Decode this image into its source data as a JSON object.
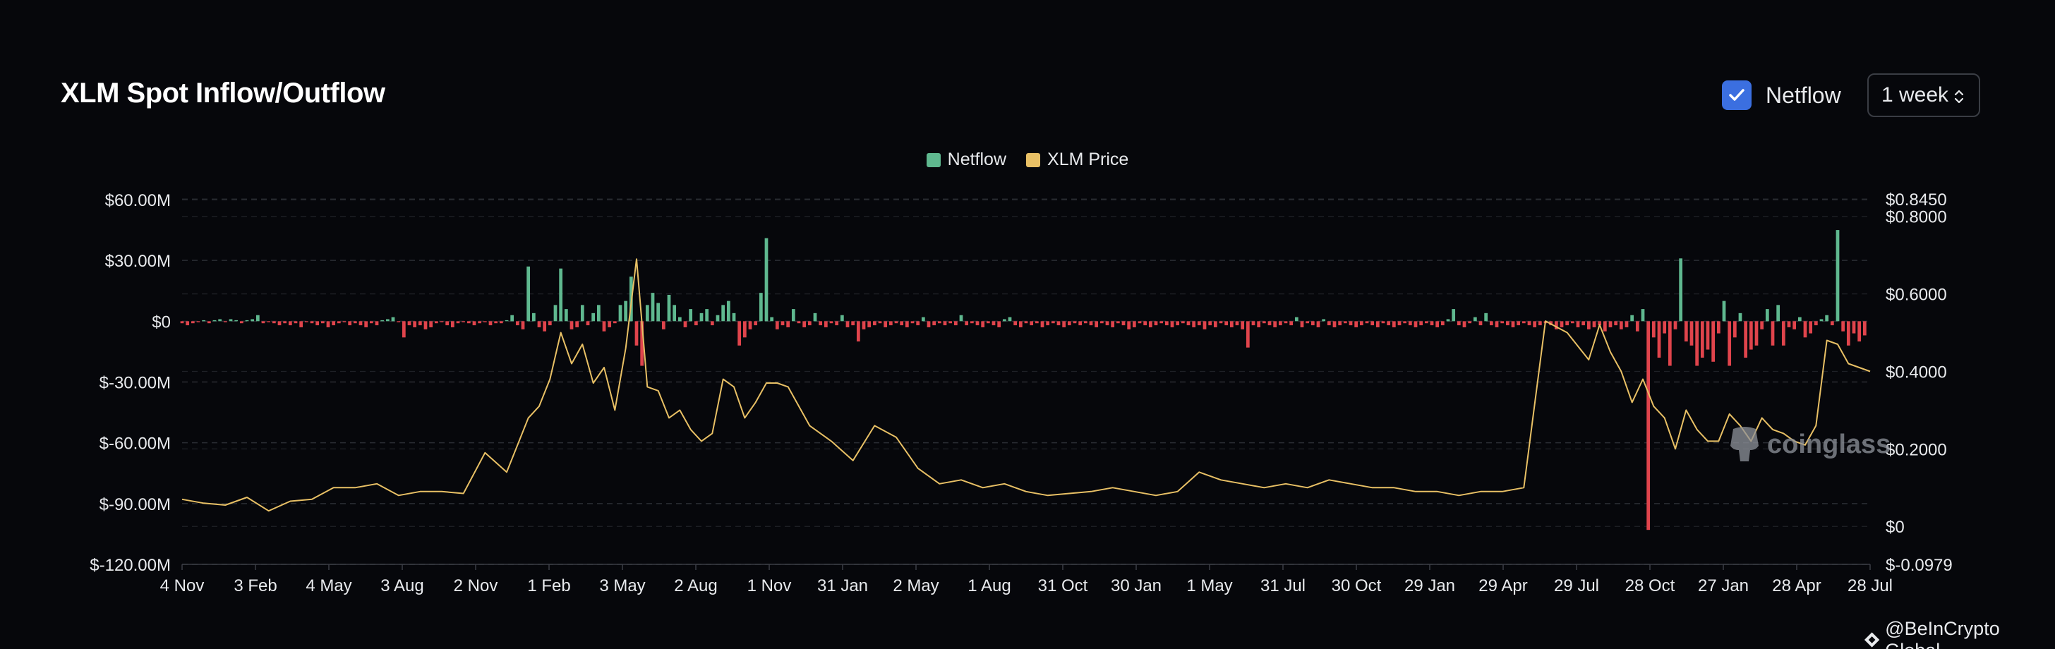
{
  "header": {
    "title": "XLM Spot Inflow/Outflow",
    "netflow_label": "Netflow",
    "netflow_checked": true,
    "period_value": "1 week"
  },
  "watermark": {
    "text": "coinglass"
  },
  "credit": {
    "text": "@BeInCrypto Global"
  },
  "colors": {
    "background": "#06070b",
    "positive": "#5fb88f",
    "negative": "#e0444c",
    "price": "#e8c065",
    "grid": "#2a2d33",
    "text": "#e8eaed",
    "accent": "#3b6fe0"
  },
  "chart_data": {
    "type": "bar+line",
    "title": "XLM Spot Inflow/Outflow",
    "legend": [
      {
        "name": "Netflow",
        "color": "#5fb88f"
      },
      {
        "name": "XLM Price",
        "color": "#e8c065"
      }
    ],
    "legend_position": "top-center",
    "grid": true,
    "x_ticks": [
      "4 Nov",
      "3 Feb",
      "4 May",
      "3 Aug",
      "2 Nov",
      "1 Feb",
      "3 May",
      "2 Aug",
      "1 Nov",
      "31 Jan",
      "2 May",
      "1 Aug",
      "31 Oct",
      "30 Jan",
      "1 May",
      "31 Jul",
      "30 Oct",
      "29 Jan",
      "29 Apr",
      "29 Jul",
      "28 Oct",
      "27 Jan",
      "28 Apr",
      "28 Jul"
    ],
    "y_left": {
      "ticks": [
        "$60.00M",
        "$30.00M",
        "$0",
        "$-30.00M",
        "$-60.00M",
        "$-90.00M",
        "$-120.00M"
      ],
      "tick_values": [
        60,
        30,
        0,
        -30,
        -60,
        -90,
        -120
      ],
      "unit": "USD millions",
      "range": [
        -120,
        60
      ]
    },
    "y_right": {
      "ticks": [
        "$0.8450",
        "$0.8000",
        "$0.6000",
        "$0.4000",
        "$0.2000",
        "$0",
        "$-0.0979"
      ],
      "tick_values": [
        0.845,
        0.8,
        0.6,
        0.4,
        0.2,
        0,
        -0.0979
      ],
      "unit": "USD",
      "range": [
        -0.0979,
        0.845
      ]
    },
    "series": [
      {
        "name": "Netflow",
        "type": "bar",
        "x_week_index": [
          0,
          1,
          2,
          3,
          4,
          5,
          6,
          7,
          8,
          9,
          10,
          11,
          12,
          13,
          14,
          15,
          16,
          17,
          18,
          19,
          20,
          21,
          22,
          23,
          24,
          25,
          26,
          27,
          28,
          29,
          30,
          31,
          32,
          33,
          34,
          35,
          36,
          37,
          38,
          39,
          40,
          41,
          42,
          43,
          44,
          45,
          46,
          47,
          48,
          49,
          50,
          51,
          52,
          53,
          54,
          55,
          56,
          57,
          58,
          59,
          60,
          61,
          62,
          63,
          64,
          65,
          66,
          67,
          68,
          69,
          70,
          71,
          72,
          73,
          74,
          75,
          76,
          77,
          78,
          79,
          80,
          81,
          82,
          83,
          84,
          85,
          86,
          87,
          88,
          89,
          90,
          91,
          92,
          93,
          94,
          95,
          96,
          97,
          98,
          99,
          100,
          101,
          102,
          103,
          104,
          105,
          106,
          107,
          108,
          109,
          110,
          111,
          112,
          113,
          114,
          115,
          116,
          117,
          118,
          119,
          120,
          121,
          122,
          123,
          124,
          125,
          126,
          127,
          128,
          129,
          130,
          131,
          132,
          133,
          134,
          135,
          136,
          137,
          138,
          139,
          140,
          141,
          142,
          143,
          144,
          145,
          146,
          147,
          148,
          149,
          150,
          151,
          152,
          153,
          154,
          155,
          156,
          157,
          158,
          159,
          160,
          161,
          162,
          163,
          164,
          165,
          166,
          167,
          168,
          169,
          170,
          171,
          172,
          173,
          174,
          175,
          176,
          177,
          178,
          179,
          180,
          181,
          182,
          183,
          184,
          185,
          186,
          187,
          188,
          189,
          190,
          191,
          192,
          193,
          194,
          195,
          196,
          197,
          198,
          199,
          200,
          201,
          202,
          203,
          204,
          205,
          206,
          207,
          208,
          209,
          210,
          211,
          212,
          213,
          214,
          215,
          216,
          217,
          218,
          219,
          220,
          221,
          222,
          223,
          224,
          225,
          226,
          227,
          228,
          229,
          230,
          231,
          232,
          233,
          234,
          235,
          236,
          237,
          238,
          239,
          240,
          241,
          242,
          243,
          244,
          245,
          246,
          247,
          248,
          249,
          250,
          251,
          252,
          253,
          254,
          255,
          256,
          257,
          258,
          259,
          260,
          261,
          262,
          263,
          264,
          265,
          266,
          267,
          268,
          269,
          270,
          271,
          272,
          273,
          274,
          275,
          276,
          277,
          278,
          279,
          280,
          281,
          282,
          283,
          284,
          285,
          286,
          287,
          288,
          289,
          290,
          291,
          292,
          293,
          294,
          295,
          296,
          297,
          298,
          299,
          300,
          301,
          302,
          303,
          304,
          305,
          306,
          307,
          308,
          309,
          310,
          311,
          312
        ],
        "values_musd": [
          -1,
          -2,
          -1,
          -0.5,
          0.5,
          -1,
          0.5,
          1,
          -0.5,
          1,
          0.5,
          -1,
          0.5,
          1,
          3,
          -1,
          -0.5,
          -1,
          -2,
          -1,
          -2,
          -1,
          -3,
          -0.5,
          -1,
          -2,
          -1,
          -3,
          -2,
          -1,
          -0.5,
          -2,
          -1,
          -2,
          -3,
          -1,
          -2,
          0.5,
          1,
          2,
          -0.5,
          -8,
          -2,
          -3,
          -2,
          -4,
          -3,
          -1,
          -0.5,
          -2,
          -3,
          -1,
          -0.5,
          -1,
          -2,
          -1,
          -0.5,
          -2,
          -1,
          -1,
          0.5,
          3,
          -2,
          -4,
          27,
          4,
          -3,
          -5,
          -2,
          8,
          26,
          6,
          -4,
          -3,
          8,
          -2,
          4,
          8,
          -5,
          -3,
          -1,
          8,
          10,
          22,
          -12,
          -22,
          8,
          14,
          9,
          -4,
          13,
          8,
          2,
          -3,
          6,
          -2,
          4,
          6,
          -2,
          3,
          8,
          10,
          4,
          -12,
          -8,
          -4,
          -2,
          14,
          41,
          2,
          -4,
          -2,
          -3,
          6,
          -1,
          -3,
          -2,
          4,
          -2,
          -3,
          -1,
          -2,
          3,
          -3,
          -2,
          -10,
          -4,
          -3,
          -2,
          -1,
          -3,
          -2,
          -1,
          -2,
          -3,
          -1,
          -2,
          2,
          -3,
          -2,
          -1,
          -2,
          -1,
          -2,
          3,
          -2,
          -1,
          -2,
          -3,
          -1,
          -2,
          -3,
          1,
          2,
          -2,
          -3,
          -1,
          -2,
          -1,
          -3,
          -2,
          -1,
          -2,
          -3,
          -2,
          -1,
          -2,
          -1,
          -2,
          -3,
          -1,
          -2,
          -3,
          -1,
          -2,
          -4,
          -3,
          -1,
          -2,
          -3,
          -2,
          -1,
          -2,
          -3,
          -2,
          -1,
          -2,
          -3,
          -2,
          -4,
          -2,
          -3,
          -1,
          -2,
          -3,
          -2,
          -4,
          -13,
          -2,
          -3,
          -1,
          -2,
          -3,
          -2,
          -1,
          -2,
          2,
          -3,
          -1,
          -2,
          -3,
          1,
          -2,
          -3,
          -2,
          -1,
          -2,
          -3,
          -2,
          -1,
          -2,
          -3,
          -1,
          -2,
          -3,
          -2,
          -1,
          -2,
          -3,
          -2,
          -1,
          -2,
          -3,
          -2,
          1,
          6,
          -2,
          -3,
          -1,
          2,
          -2,
          4,
          -2,
          -3,
          -1,
          -2,
          -3,
          -2,
          -1,
          -2,
          -3,
          -2,
          -1,
          -2,
          -4,
          -3,
          -2,
          -1,
          -3,
          -2,
          -4,
          -3,
          -2,
          -5,
          -3,
          -2,
          -4,
          -3,
          3,
          -5,
          6,
          -103,
          -8,
          -18,
          -6,
          -22,
          -4,
          31,
          -10,
          -12,
          -22,
          -18,
          -14,
          -20,
          -6,
          10,
          -22,
          -8,
          4,
          -18,
          -14,
          -12,
          -4,
          6,
          -12,
          8,
          -12,
          -3,
          -4,
          2,
          -8,
          -6,
          -2,
          1,
          3,
          -2,
          45,
          -5,
          -12,
          -6,
          -10,
          -7
        ],
        "note": "bar heights read off the left axis, approximate"
      },
      {
        "name": "XLM Price",
        "type": "line",
        "x_week_index": [
          0,
          4,
          8,
          12,
          16,
          20,
          24,
          28,
          32,
          36,
          40,
          44,
          48,
          52,
          56,
          60,
          64,
          66,
          68,
          70,
          72,
          74,
          76,
          78,
          80,
          82,
          84,
          86,
          88,
          90,
          92,
          94,
          96,
          98,
          100,
          102,
          104,
          106,
          108,
          110,
          112,
          116,
          120,
          124,
          128,
          132,
          136,
          140,
          144,
          148,
          152,
          156,
          160,
          164,
          168,
          172,
          176,
          180,
          184,
          188,
          192,
          196,
          200,
          204,
          208,
          212,
          216,
          220,
          224,
          228,
          232,
          236,
          240,
          244,
          248,
          252,
          256,
          260,
          262,
          264,
          266,
          268,
          270,
          272,
          274,
          276,
          278,
          280,
          282,
          284,
          286,
          288,
          290,
          292,
          294,
          296,
          298,
          300,
          302,
          304,
          306,
          308,
          310,
          312
        ],
        "values_usd": [
          0.07,
          0.06,
          0.055,
          0.075,
          0.04,
          0.065,
          0.07,
          0.1,
          0.1,
          0.11,
          0.08,
          0.09,
          0.09,
          0.085,
          0.19,
          0.14,
          0.28,
          0.31,
          0.38,
          0.5,
          0.42,
          0.47,
          0.37,
          0.41,
          0.3,
          0.46,
          0.69,
          0.36,
          0.35,
          0.28,
          0.3,
          0.25,
          0.22,
          0.24,
          0.38,
          0.36,
          0.28,
          0.32,
          0.37,
          0.37,
          0.36,
          0.26,
          0.22,
          0.17,
          0.26,
          0.23,
          0.15,
          0.11,
          0.12,
          0.1,
          0.11,
          0.09,
          0.08,
          0.085,
          0.09,
          0.1,
          0.09,
          0.08,
          0.09,
          0.14,
          0.12,
          0.11,
          0.1,
          0.11,
          0.1,
          0.12,
          0.11,
          0.1,
          0.1,
          0.09,
          0.09,
          0.08,
          0.09,
          0.09,
          0.1,
          0.53,
          0.5,
          0.43,
          0.52,
          0.45,
          0.4,
          0.32,
          0.38,
          0.31,
          0.28,
          0.2,
          0.3,
          0.25,
          0.22,
          0.22,
          0.29,
          0.26,
          0.22,
          0.28,
          0.25,
          0.24,
          0.22,
          0.21,
          0.26,
          0.48,
          0.47,
          0.42,
          0.41,
          0.4
        ],
        "note": "price read off the right axis, approximate"
      }
    ]
  }
}
